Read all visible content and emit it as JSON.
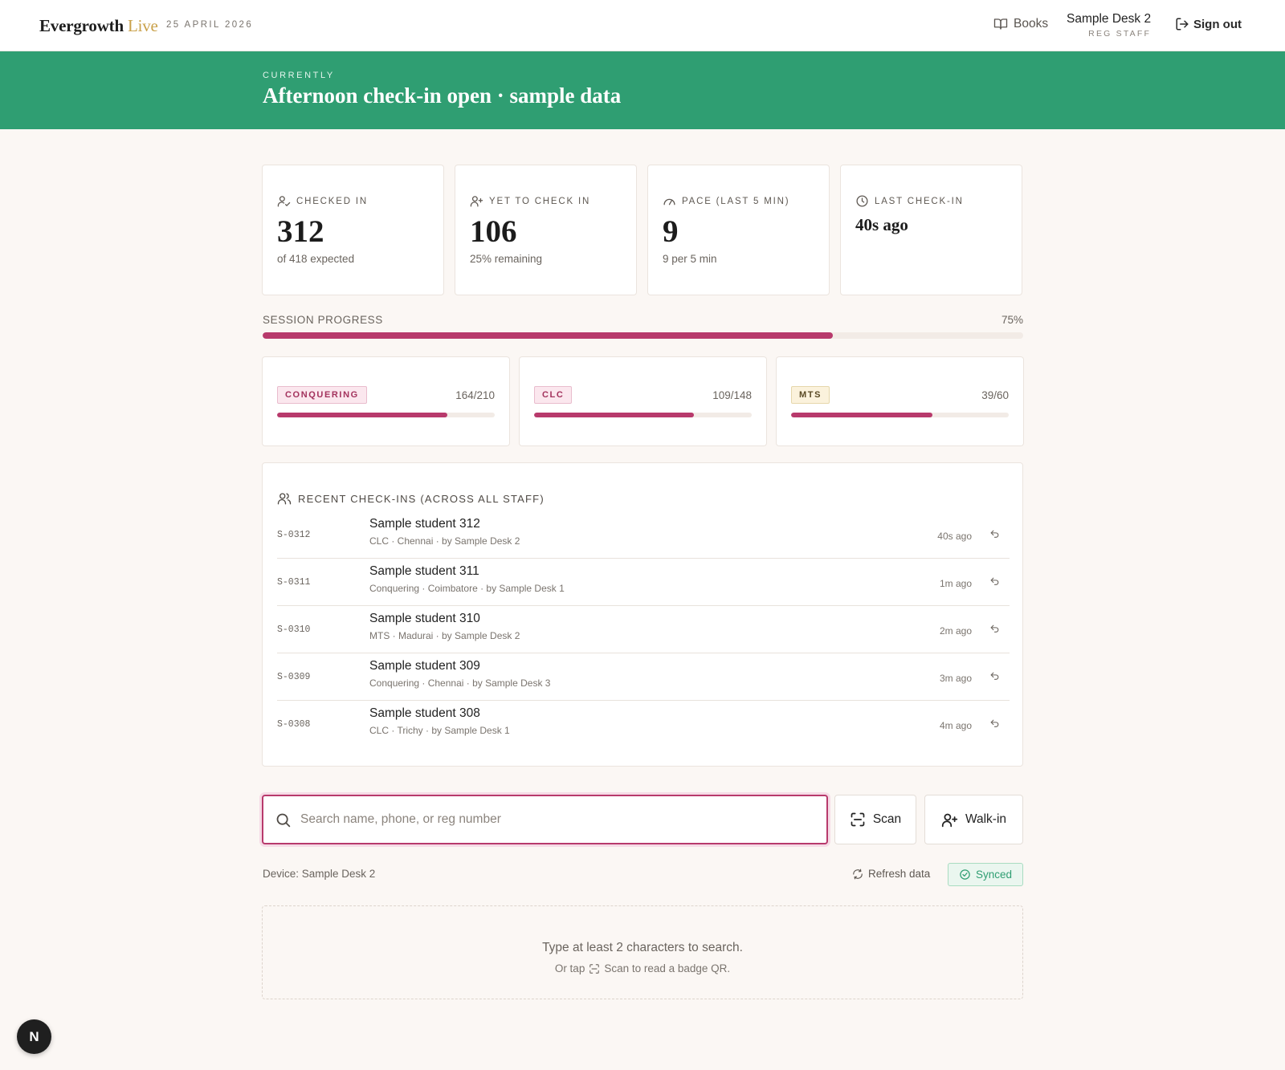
{
  "header": {
    "brand_main": "Evergrowth",
    "brand_accent": "Live",
    "date": "25 APRIL 2026",
    "books_label": "Books",
    "desk_name": "Sample Desk 2",
    "desk_role": "REG STAFF",
    "signout_label": "Sign out"
  },
  "banner": {
    "eyebrow": "CURRENTLY",
    "title": "Afternoon check-in open · sample data",
    "color": "#2f9e72"
  },
  "stats": [
    {
      "icon": "user-check-icon",
      "label": "CHECKED IN",
      "value": "312",
      "sub": "of 418 expected"
    },
    {
      "icon": "user-plus-icon",
      "label": "YET TO CHECK IN",
      "value": "106",
      "sub": "25% remaining"
    },
    {
      "icon": "gauge-icon",
      "label": "PACE (LAST 5 MIN)",
      "value": "9",
      "sub": "9 per 5 min"
    },
    {
      "icon": "clock-icon",
      "label": "LAST CHECK-IN",
      "value": "40s ago",
      "sub": ""
    }
  ],
  "session_progress": {
    "label": "SESSION PROGRESS",
    "percent_label": "75%",
    "fraction": 0.75,
    "color": "#b83a6c"
  },
  "tracks": [
    {
      "name": "CONQUERING",
      "count": "164/210",
      "fraction": 0.781,
      "badge_style": "pink"
    },
    {
      "name": "CLC",
      "count": "109/148",
      "fraction": 0.736,
      "badge_style": "pink"
    },
    {
      "name": "MTS",
      "count": "39/60",
      "fraction": 0.65,
      "badge_style": "yellow"
    }
  ],
  "recent": {
    "title": "RECENT CHECK-INS (ACROSS ALL STAFF)",
    "rows": [
      {
        "id": "S-0312",
        "name": "Sample student 312",
        "meta": "CLC · Chennai · by Sample Desk 2",
        "time": "40s ago"
      },
      {
        "id": "S-0311",
        "name": "Sample student 311",
        "meta": "Conquering · Coimbatore · by Sample Desk 1",
        "time": "1m ago"
      },
      {
        "id": "S-0310",
        "name": "Sample student 310",
        "meta": "MTS · Madurai · by Sample Desk 2",
        "time": "2m ago"
      },
      {
        "id": "S-0309",
        "name": "Sample student 309",
        "meta": "Conquering · Chennai · by Sample Desk 3",
        "time": "3m ago"
      },
      {
        "id": "S-0308",
        "name": "Sample student 308",
        "meta": "CLC · Trichy · by Sample Desk 1",
        "time": "4m ago"
      }
    ]
  },
  "search": {
    "placeholder": "Search name, phone, or reg number",
    "value": "",
    "scan_label": "Scan",
    "walkin_label": "Walk-in"
  },
  "status": {
    "device": "Device: Sample Desk 2",
    "refresh_label": "Refresh data",
    "synced_label": "Synced"
  },
  "hint": {
    "main": "Type at least 2 characters to search.",
    "sub_before": "Or tap",
    "sub_after": "Scan to read a badge QR."
  },
  "dev_badge": "N"
}
